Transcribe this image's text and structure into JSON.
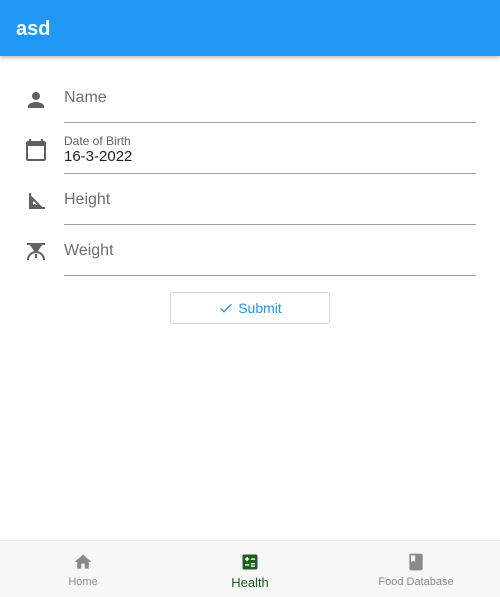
{
  "app_bar": {
    "title": "asd",
    "color": "#2196f3"
  },
  "form": {
    "name": {
      "icon": "person-icon",
      "placeholder": "Name",
      "value": ""
    },
    "dob": {
      "icon": "calendar-icon",
      "label": "Date of Birth",
      "value": "16-3-2022"
    },
    "height": {
      "icon": "ruler-triangle-icon",
      "placeholder": "Height",
      "value": ""
    },
    "weight": {
      "icon": "scale-icon",
      "placeholder": "Weight",
      "value": ""
    },
    "submit": {
      "icon": "check-icon",
      "label": "Submit"
    }
  },
  "bottom_nav": {
    "items": [
      {
        "label": "Home",
        "icon": "home-icon",
        "active": false
      },
      {
        "label": "Health",
        "icon": "calculator-icon",
        "active": true
      },
      {
        "label": "Food Database",
        "icon": "book-icon",
        "active": false
      }
    ],
    "active_color": "#1b5e20",
    "inactive_color": "#8a8a8a"
  }
}
